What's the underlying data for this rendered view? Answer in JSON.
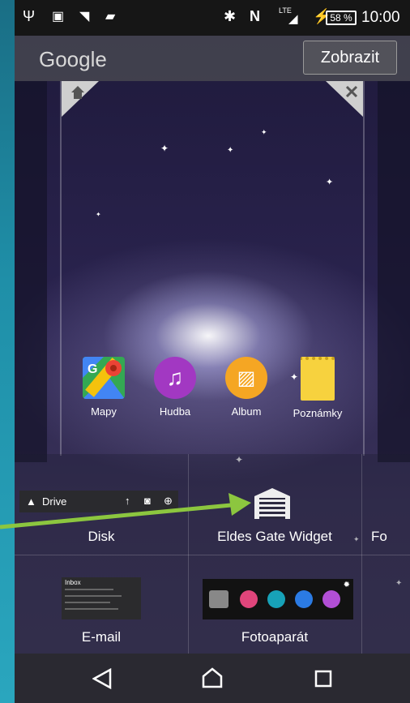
{
  "status_bar": {
    "battery_percent": "58 %",
    "time": "10:00",
    "network": "LTE"
  },
  "google_bar": {
    "logo": "Google",
    "show_button": "Zobrazit"
  },
  "home_apps": [
    {
      "label": "Mapy",
      "icon": "maps-icon"
    },
    {
      "label": "Hudba",
      "icon": "music-icon"
    },
    {
      "label": "Album",
      "icon": "album-icon"
    },
    {
      "label": "Poznámky",
      "icon": "notes-icon"
    }
  ],
  "widgets": {
    "disk": {
      "label": "Disk",
      "preview_title": "Drive"
    },
    "eldes": {
      "label": "Eldes Gate Widget"
    },
    "partial": {
      "label": "Fo"
    },
    "email": {
      "label": "E-mail",
      "preview_title": "Inbox"
    },
    "camera": {
      "label": "Fotoaparát"
    }
  },
  "colors": {
    "arrow": "#8cc63f",
    "music": "#a238c2",
    "album": "#f5a623",
    "notes": "#f7d23e"
  }
}
